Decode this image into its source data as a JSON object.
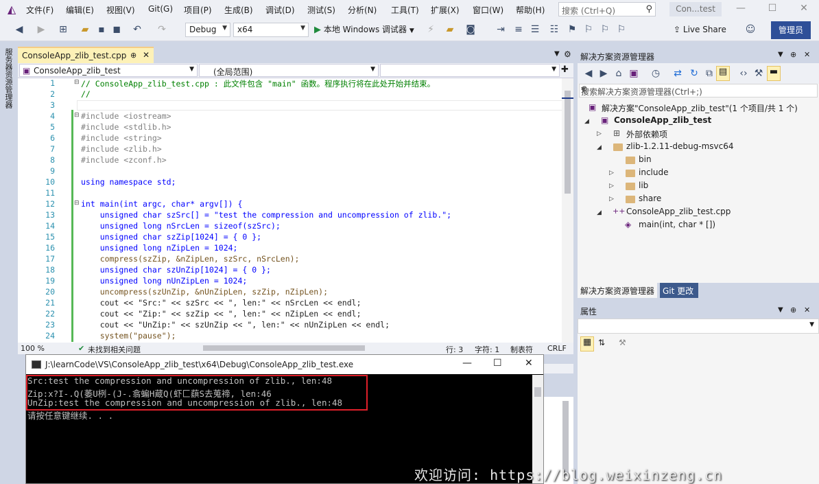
{
  "menu": {
    "items": [
      "文件(F)",
      "编辑(E)",
      "视图(V)",
      "Git(G)",
      "项目(P)",
      "生成(B)",
      "调试(D)",
      "测试(S)",
      "分析(N)",
      "工具(T)",
      "扩展(X)",
      "窗口(W)",
      "帮助(H)"
    ],
    "search_placeholder": "搜索 (Ctrl+Q)",
    "title_badge": "Con...test"
  },
  "toolbar": {
    "config": "Debug",
    "platform": "x64",
    "run_label": "本地 Windows 调试器",
    "live_share": "Live Share",
    "admin": "管理员"
  },
  "left_strip": {
    "label": "服务器资源管理器"
  },
  "editor": {
    "tab_label": "ConsoleApp_zlib_test.cpp",
    "nav_project": "ConsoleApp_zlib_test",
    "nav_scope": "(全局范围)",
    "lines": [
      {
        "n": "1",
        "text": "// ConsoleApp_zlib_test.cpp : 此文件包含 \"main\" 函数。程序执行将在此处开始并结束。"
      },
      {
        "n": "2",
        "text": "//"
      },
      {
        "n": "3",
        "text": ""
      },
      {
        "n": "4",
        "text": "#include <iostream>"
      },
      {
        "n": "5",
        "text": "#include <stdlib.h>"
      },
      {
        "n": "6",
        "text": "#include <string>"
      },
      {
        "n": "7",
        "text": "#include <zlib.h>"
      },
      {
        "n": "8",
        "text": "#include <zconf.h>"
      },
      {
        "n": "9",
        "text": ""
      },
      {
        "n": "10",
        "text": "using namespace std;"
      },
      {
        "n": "11",
        "text": ""
      },
      {
        "n": "12",
        "text": "int main(int argc, char* argv[]) {"
      },
      {
        "n": "13",
        "text": "    unsigned char szSrc[] = \"test the compression and uncompression of zlib.\";"
      },
      {
        "n": "14",
        "text": "    unsigned long nSrcLen = sizeof(szSrc);"
      },
      {
        "n": "15",
        "text": "    unsigned char szZip[1024] = { 0 };"
      },
      {
        "n": "16",
        "text": "    unsigned long nZipLen = 1024;"
      },
      {
        "n": "17",
        "text": "    compress(szZip, &nZipLen, szSrc, nSrcLen);"
      },
      {
        "n": "18",
        "text": "    unsigned char szUnZip[1024] = { 0 };"
      },
      {
        "n": "19",
        "text": "    unsigned long nUnZipLen = 1024;"
      },
      {
        "n": "20",
        "text": "    uncompress(szUnZip, &nUnZipLen, szZip, nZipLen);"
      },
      {
        "n": "21",
        "text": "    cout << \"Src:\" << szSrc << \", len:\" << nSrcLen << endl;"
      },
      {
        "n": "22",
        "text": "    cout << \"Zip:\" << szZip << \", len:\" << nZipLen << endl;"
      },
      {
        "n": "23",
        "text": "    cout << \"UnZip:\" << szUnZip << \", len:\" << nUnZipLen << endl;"
      },
      {
        "n": "24",
        "text": "    system(\"pause\");"
      }
    ],
    "status": {
      "zoom": "100 %",
      "issues": "未找到相关问题",
      "line": "行: 3",
      "char": "字符: 1",
      "tab": "制表符",
      "eol": "CRLF"
    }
  },
  "solution_explorer": {
    "title": "解决方案资源管理器",
    "search_placeholder": "搜索解决方案资源管理器(Ctrl+;)",
    "solution": "解决方案\"ConsoleApp_zlib_test\"(1 个项目/共 1 个)",
    "project": "ConsoleApp_zlib_test",
    "external_deps": "外部依赖项",
    "zlib_folder": "zlib-1.2.11-debug-msvc64",
    "sub_folders": [
      "bin",
      "include",
      "lib",
      "share"
    ],
    "cpp_file": "ConsoleApp_zlib_test.cpp",
    "main_fn": "main(int, char * [])",
    "tab_active": "解决方案资源管理器",
    "tab_git": "Git 更改"
  },
  "properties": {
    "title": "属性"
  },
  "console": {
    "title": "J:\\learnCode\\VS\\ConsoleApp_zlib_test\\x64\\Debug\\ConsoleApp_zlib_test.exe",
    "lines": [
      "Src:test the compression and uncompression of zlib., len:48",
      "Zip:x?I-.Q(萎U栵-(J-.翕蝙H蔵Q(虾匚蕻S去蒐禘, len:46",
      "UnZip:test the compression and uncompression of zlib., len:48",
      "请按任意键继续. . ."
    ]
  },
  "watermark": "欢迎访问: https://blog.weixinzeng.cn",
  "colors": {
    "accent": "#2e4f98",
    "tab_active": "#fdf1b7",
    "highlight": "#e0202a"
  }
}
